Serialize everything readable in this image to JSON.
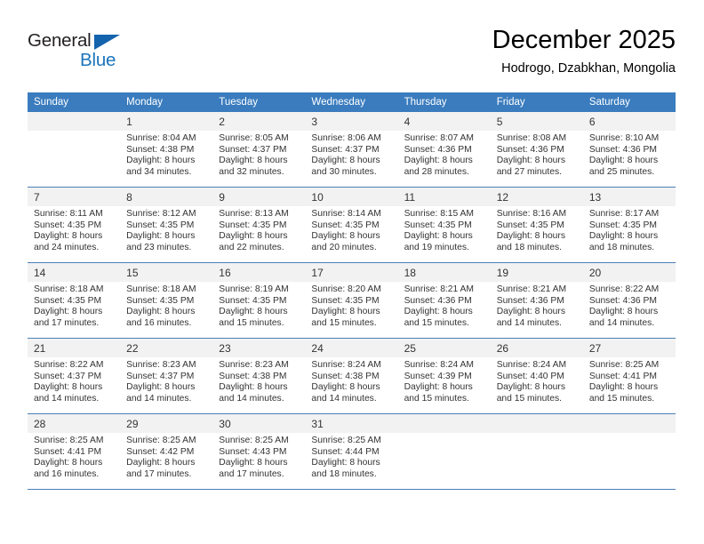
{
  "logo": {
    "word1": "General",
    "word2": "Blue",
    "triangle_color": "#1463ad",
    "word2_color": "#1b75bc"
  },
  "header": {
    "title": "December 2025",
    "subtitle": "Hodrogo, Dzabkhan, Mongolia"
  },
  "theme": {
    "header_row_bg": "#3a7cbe",
    "daynum_bg": "#f2f2f2",
    "grid_line": "#4a7fb5",
    "text": "#333333"
  },
  "calendar": {
    "weekday_headers": [
      "Sunday",
      "Monday",
      "Tuesday",
      "Wednesday",
      "Thursday",
      "Friday",
      "Saturday"
    ],
    "labels": {
      "sunrise": "Sunrise:",
      "sunset": "Sunset:",
      "daylight": "Daylight:"
    },
    "weeks": [
      [
        {
          "empty": true,
          "day": "",
          "sunrise": "",
          "sunset": "",
          "daylight_line1": "",
          "daylight_line2": ""
        },
        {
          "empty": false,
          "day": "1",
          "sunrise": "Sunrise: 8:04 AM",
          "sunset": "Sunset: 4:38 PM",
          "daylight_line1": "Daylight: 8 hours",
          "daylight_line2": "and 34 minutes."
        },
        {
          "empty": false,
          "day": "2",
          "sunrise": "Sunrise: 8:05 AM",
          "sunset": "Sunset: 4:37 PM",
          "daylight_line1": "Daylight: 8 hours",
          "daylight_line2": "and 32 minutes."
        },
        {
          "empty": false,
          "day": "3",
          "sunrise": "Sunrise: 8:06 AM",
          "sunset": "Sunset: 4:37 PM",
          "daylight_line1": "Daylight: 8 hours",
          "daylight_line2": "and 30 minutes."
        },
        {
          "empty": false,
          "day": "4",
          "sunrise": "Sunrise: 8:07 AM",
          "sunset": "Sunset: 4:36 PM",
          "daylight_line1": "Daylight: 8 hours",
          "daylight_line2": "and 28 minutes."
        },
        {
          "empty": false,
          "day": "5",
          "sunrise": "Sunrise: 8:08 AM",
          "sunset": "Sunset: 4:36 PM",
          "daylight_line1": "Daylight: 8 hours",
          "daylight_line2": "and 27 minutes."
        },
        {
          "empty": false,
          "day": "6",
          "sunrise": "Sunrise: 8:10 AM",
          "sunset": "Sunset: 4:36 PM",
          "daylight_line1": "Daylight: 8 hours",
          "daylight_line2": "and 25 minutes."
        }
      ],
      [
        {
          "empty": false,
          "day": "7",
          "sunrise": "Sunrise: 8:11 AM",
          "sunset": "Sunset: 4:35 PM",
          "daylight_line1": "Daylight: 8 hours",
          "daylight_line2": "and 24 minutes."
        },
        {
          "empty": false,
          "day": "8",
          "sunrise": "Sunrise: 8:12 AM",
          "sunset": "Sunset: 4:35 PM",
          "daylight_line1": "Daylight: 8 hours",
          "daylight_line2": "and 23 minutes."
        },
        {
          "empty": false,
          "day": "9",
          "sunrise": "Sunrise: 8:13 AM",
          "sunset": "Sunset: 4:35 PM",
          "daylight_line1": "Daylight: 8 hours",
          "daylight_line2": "and 22 minutes."
        },
        {
          "empty": false,
          "day": "10",
          "sunrise": "Sunrise: 8:14 AM",
          "sunset": "Sunset: 4:35 PM",
          "daylight_line1": "Daylight: 8 hours",
          "daylight_line2": "and 20 minutes."
        },
        {
          "empty": false,
          "day": "11",
          "sunrise": "Sunrise: 8:15 AM",
          "sunset": "Sunset: 4:35 PM",
          "daylight_line1": "Daylight: 8 hours",
          "daylight_line2": "and 19 minutes."
        },
        {
          "empty": false,
          "day": "12",
          "sunrise": "Sunrise: 8:16 AM",
          "sunset": "Sunset: 4:35 PM",
          "daylight_line1": "Daylight: 8 hours",
          "daylight_line2": "and 18 minutes."
        },
        {
          "empty": false,
          "day": "13",
          "sunrise": "Sunrise: 8:17 AM",
          "sunset": "Sunset: 4:35 PM",
          "daylight_line1": "Daylight: 8 hours",
          "daylight_line2": "and 18 minutes."
        }
      ],
      [
        {
          "empty": false,
          "day": "14",
          "sunrise": "Sunrise: 8:18 AM",
          "sunset": "Sunset: 4:35 PM",
          "daylight_line1": "Daylight: 8 hours",
          "daylight_line2": "and 17 minutes."
        },
        {
          "empty": false,
          "day": "15",
          "sunrise": "Sunrise: 8:18 AM",
          "sunset": "Sunset: 4:35 PM",
          "daylight_line1": "Daylight: 8 hours",
          "daylight_line2": "and 16 minutes."
        },
        {
          "empty": false,
          "day": "16",
          "sunrise": "Sunrise: 8:19 AM",
          "sunset": "Sunset: 4:35 PM",
          "daylight_line1": "Daylight: 8 hours",
          "daylight_line2": "and 15 minutes."
        },
        {
          "empty": false,
          "day": "17",
          "sunrise": "Sunrise: 8:20 AM",
          "sunset": "Sunset: 4:35 PM",
          "daylight_line1": "Daylight: 8 hours",
          "daylight_line2": "and 15 minutes."
        },
        {
          "empty": false,
          "day": "18",
          "sunrise": "Sunrise: 8:21 AM",
          "sunset": "Sunset: 4:36 PM",
          "daylight_line1": "Daylight: 8 hours",
          "daylight_line2": "and 15 minutes."
        },
        {
          "empty": false,
          "day": "19",
          "sunrise": "Sunrise: 8:21 AM",
          "sunset": "Sunset: 4:36 PM",
          "daylight_line1": "Daylight: 8 hours",
          "daylight_line2": "and 14 minutes."
        },
        {
          "empty": false,
          "day": "20",
          "sunrise": "Sunrise: 8:22 AM",
          "sunset": "Sunset: 4:36 PM",
          "daylight_line1": "Daylight: 8 hours",
          "daylight_line2": "and 14 minutes."
        }
      ],
      [
        {
          "empty": false,
          "day": "21",
          "sunrise": "Sunrise: 8:22 AM",
          "sunset": "Sunset: 4:37 PM",
          "daylight_line1": "Daylight: 8 hours",
          "daylight_line2": "and 14 minutes."
        },
        {
          "empty": false,
          "day": "22",
          "sunrise": "Sunrise: 8:23 AM",
          "sunset": "Sunset: 4:37 PM",
          "daylight_line1": "Daylight: 8 hours",
          "daylight_line2": "and 14 minutes."
        },
        {
          "empty": false,
          "day": "23",
          "sunrise": "Sunrise: 8:23 AM",
          "sunset": "Sunset: 4:38 PM",
          "daylight_line1": "Daylight: 8 hours",
          "daylight_line2": "and 14 minutes."
        },
        {
          "empty": false,
          "day": "24",
          "sunrise": "Sunrise: 8:24 AM",
          "sunset": "Sunset: 4:38 PM",
          "daylight_line1": "Daylight: 8 hours",
          "daylight_line2": "and 14 minutes."
        },
        {
          "empty": false,
          "day": "25",
          "sunrise": "Sunrise: 8:24 AM",
          "sunset": "Sunset: 4:39 PM",
          "daylight_line1": "Daylight: 8 hours",
          "daylight_line2": "and 15 minutes."
        },
        {
          "empty": false,
          "day": "26",
          "sunrise": "Sunrise: 8:24 AM",
          "sunset": "Sunset: 4:40 PM",
          "daylight_line1": "Daylight: 8 hours",
          "daylight_line2": "and 15 minutes."
        },
        {
          "empty": false,
          "day": "27",
          "sunrise": "Sunrise: 8:25 AM",
          "sunset": "Sunset: 4:41 PM",
          "daylight_line1": "Daylight: 8 hours",
          "daylight_line2": "and 15 minutes."
        }
      ],
      [
        {
          "empty": false,
          "day": "28",
          "sunrise": "Sunrise: 8:25 AM",
          "sunset": "Sunset: 4:41 PM",
          "daylight_line1": "Daylight: 8 hours",
          "daylight_line2": "and 16 minutes."
        },
        {
          "empty": false,
          "day": "29",
          "sunrise": "Sunrise: 8:25 AM",
          "sunset": "Sunset: 4:42 PM",
          "daylight_line1": "Daylight: 8 hours",
          "daylight_line2": "and 17 minutes."
        },
        {
          "empty": false,
          "day": "30",
          "sunrise": "Sunrise: 8:25 AM",
          "sunset": "Sunset: 4:43 PM",
          "daylight_line1": "Daylight: 8 hours",
          "daylight_line2": "and 17 minutes."
        },
        {
          "empty": false,
          "day": "31",
          "sunrise": "Sunrise: 8:25 AM",
          "sunset": "Sunset: 4:44 PM",
          "daylight_line1": "Daylight: 8 hours",
          "daylight_line2": "and 18 minutes."
        },
        {
          "empty": true,
          "day": "",
          "sunrise": "",
          "sunset": "",
          "daylight_line1": "",
          "daylight_line2": ""
        },
        {
          "empty": true,
          "day": "",
          "sunrise": "",
          "sunset": "",
          "daylight_line1": "",
          "daylight_line2": ""
        },
        {
          "empty": true,
          "day": "",
          "sunrise": "",
          "sunset": "",
          "daylight_line1": "",
          "daylight_line2": ""
        }
      ]
    ]
  }
}
